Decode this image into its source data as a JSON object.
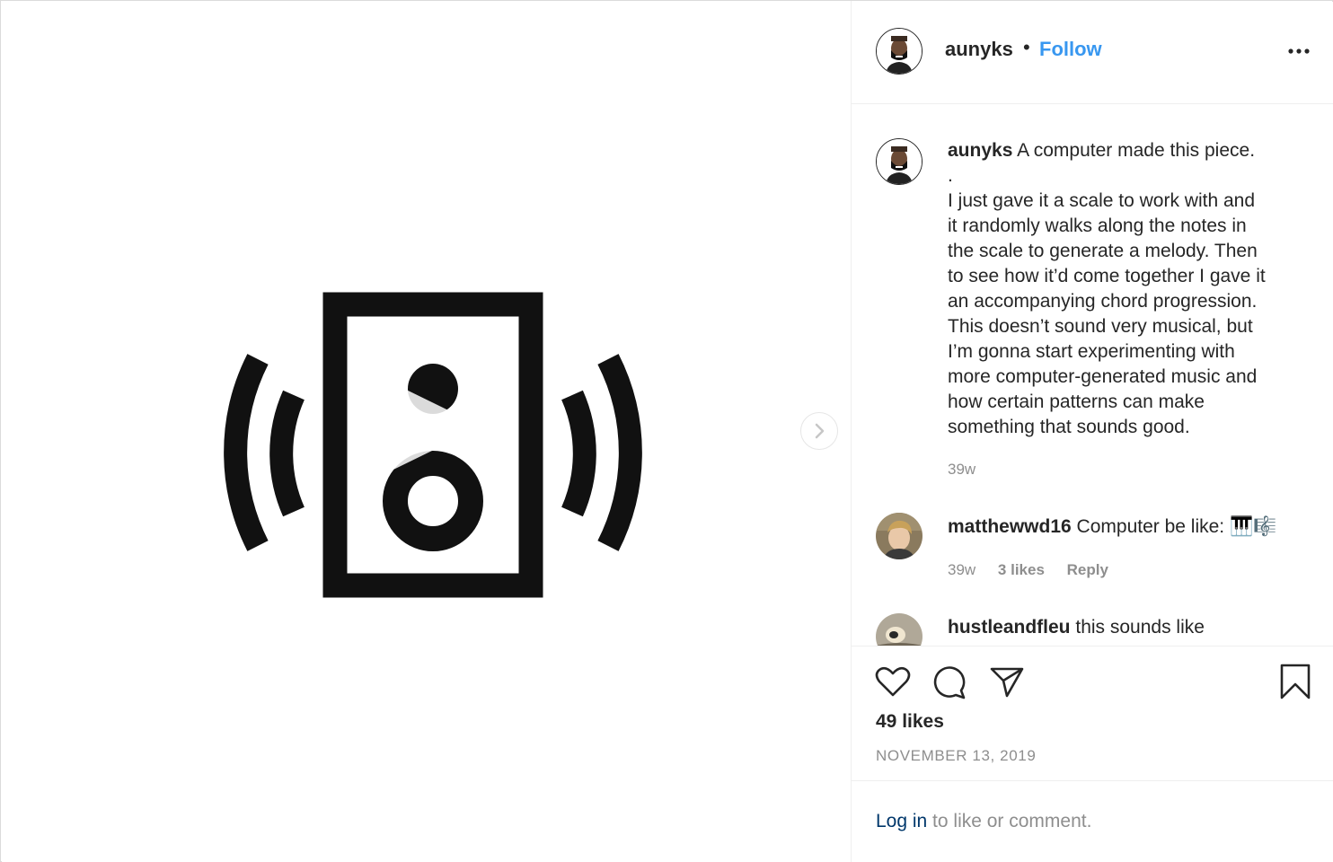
{
  "post": {
    "author": "aunyks",
    "follow_label": "Follow",
    "separator": "•",
    "caption_lines": [
      "A computer made this piece.",
      ".",
      "I just gave it a scale to work with and",
      "it randomly walks along the notes in",
      "the scale to generate a melody. Then",
      "to see how it’d come together I gave it",
      "an accompanying chord progression.",
      "This doesn’t sound very musical, but",
      "I’m gonna start experimenting with",
      "more computer-generated music and",
      "how certain patterns can make",
      "something that sounds good."
    ],
    "caption_time": "39w",
    "likes": "49 likes",
    "date": "NOVEMBER 13, 2019"
  },
  "comments": [
    {
      "user": "matthewwd16",
      "text": "Computer be like: 🎹🎼",
      "time": "39w",
      "likes": "3 likes",
      "reply_label": "Reply"
    },
    {
      "user": "hustleandfleu",
      "text": "this sounds like"
    }
  ],
  "login": {
    "link": "Log in",
    "rest": " to like or comment."
  },
  "colors": {
    "accent": "#3897f0",
    "text": "#262626",
    "muted": "#8e8e8e",
    "link": "#00376b"
  },
  "icons": [
    "speaker-icon",
    "play-icon",
    "chevron-right-icon",
    "more-icon",
    "heart-icon",
    "comment-icon",
    "share-icon",
    "bookmark-icon"
  ]
}
